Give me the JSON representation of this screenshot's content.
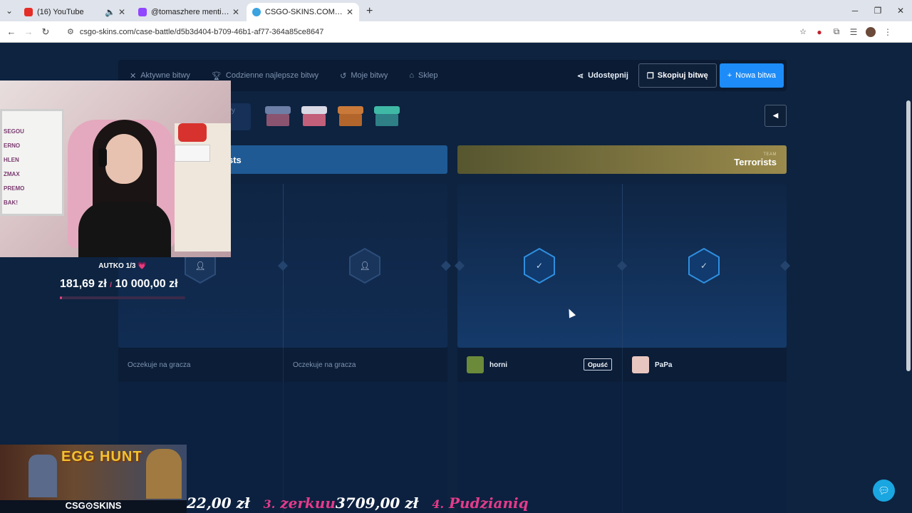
{
  "browser": {
    "tabs": [
      {
        "label": "(16) YouTube",
        "favicon_color": "#e52d27",
        "active": false
      },
      {
        "label": "@tomaszhere mentioned y",
        "favicon_color": "#9146ff",
        "active": false
      },
      {
        "label": "CSGO-SKINS.COM - Najlepsze",
        "favicon_color": "#3aa3e0",
        "active": true
      }
    ],
    "new_tab": "+",
    "url": "csgo-skins.com/case-battle/d5b3d404-b709-46b1-af77-364a85ce8647"
  },
  "nav": {
    "items": [
      {
        "label": "Aktywne bitwy",
        "icon": "swords-icon"
      },
      {
        "label": "Codzienne najlepsze bitwy",
        "icon": "trophy-icon"
      },
      {
        "label": "Moje bitwy",
        "icon": "history-icon"
      },
      {
        "label": "Sklep",
        "icon": "basket-icon"
      }
    ],
    "share_label": "Udostępnij",
    "copy_label": "Skopiuj bitwę",
    "new_battle_label": "Nowa bitwa"
  },
  "rounds_label": "twy",
  "cases": [
    {
      "lid": "#6d7fa6",
      "body": "#8a5470"
    },
    {
      "lid": "#d9d9e6",
      "body": "#c25f7a"
    },
    {
      "lid": "#c97a3a",
      "body": "#b3662c"
    },
    {
      "lid": "#3fb9a6",
      "body": "#2e7f86"
    }
  ],
  "teams": {
    "ct": {
      "name": "sts"
    },
    "t": {
      "small": "TEAM",
      "name": "Terrorists"
    }
  },
  "slots": [
    {
      "status": "Oczekuje na gracza"
    },
    {
      "status": "Oczekuje na gracza"
    },
    {
      "player": "horni",
      "leave_label": "Opuść",
      "avatar_color": "#6b8a3a"
    },
    {
      "player": "PaPa",
      "avatar_color": "#e8c6c0"
    }
  ],
  "overlay": {
    "goal_title": "AUTKO 1/3 💗",
    "goal_current": "181,69 zł",
    "goal_sep": "/",
    "goal_target": "10 000,00 zł",
    "goal_progress": 0.018,
    "egg_title": "EGG HUNT",
    "egg_logo": "CSG⊙SKINS",
    "whiteboard_lines": [
      "SEGOU",
      "ERNO",
      "HLEN",
      "ZMAX",
      "PREMO",
      "BAK!"
    ],
    "ticker": [
      {
        "amount": "22,00 zł"
      },
      {
        "rank": "3.",
        "name": "zerkuu",
        "amount": "3709,00 zł"
      },
      {
        "rank": "4.",
        "name": "Pudzianiq"
      }
    ]
  }
}
